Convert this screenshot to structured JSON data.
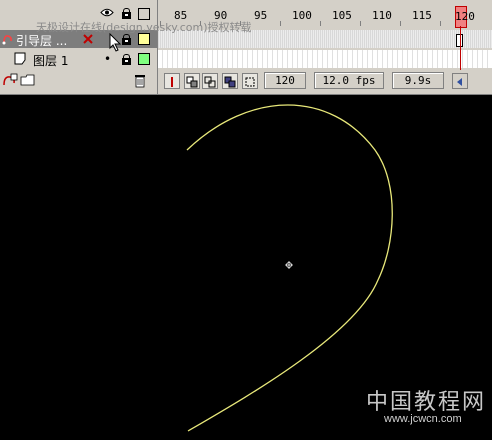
{
  "watermark": "天极设计在线(design.yesky.com)授权转载",
  "layers": [
    {
      "name": "引导层 ...",
      "visible_dot": "•",
      "color": "#ffff99",
      "selected": true
    },
    {
      "name": "图层 1",
      "visible_dot": "•",
      "color": "#80ff80",
      "selected": false
    }
  ],
  "ruler": {
    "labels": [
      "85",
      "90",
      "95",
      "100",
      "105",
      "110",
      "115",
      "120"
    ]
  },
  "status": {
    "current_frame": "120",
    "frame_rate": "12.0 fps",
    "elapsed": "9.9s"
  },
  "stage": {
    "background": "#000000",
    "path_color": "#e8e87a"
  },
  "logo": {
    "text": "中国教程网",
    "url": "www.jcwcn.com"
  }
}
